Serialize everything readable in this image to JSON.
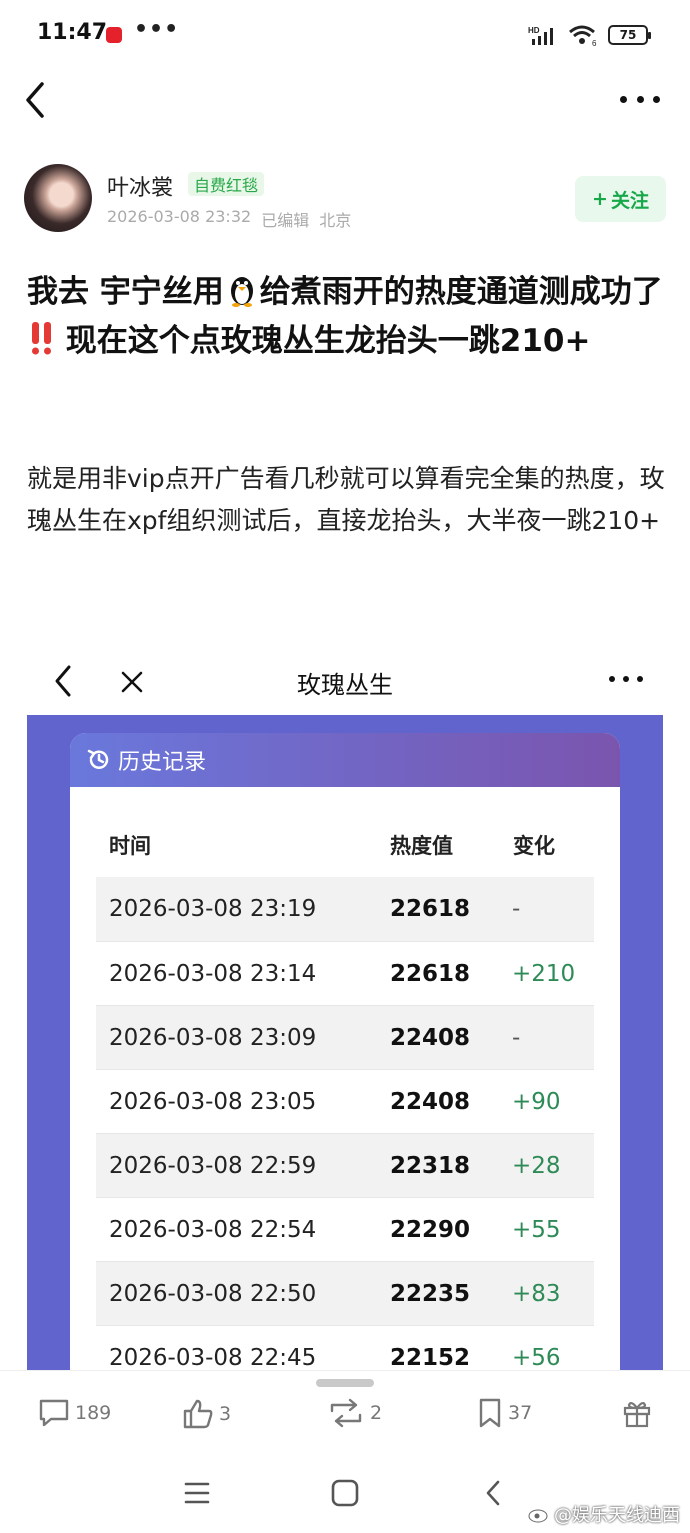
{
  "status_bar": {
    "time": "11:47",
    "more_dots": "•••",
    "network": "HD",
    "wifi_sub": "6",
    "battery": "75"
  },
  "author": {
    "name": "叶冰裳",
    "badge": "自费红毯",
    "date": "2026-03-08 23:32",
    "edited": "已编辑",
    "location": "北京",
    "follow_label": "关注",
    "follow_plus": "+"
  },
  "post": {
    "title_part1": "我去 宇宁丝用",
    "title_part2": "给煮雨开的热度通道测成功了",
    "title_part3": " 现在这个点玫瑰丛生龙抬头一跳210+",
    "body": "就是用非vip点开广告看几秒就可以算看完全集的热度，玫瑰丛生在xpf组织测试后，直接龙抬头，大半夜一跳210+"
  },
  "embed": {
    "title": "玫瑰丛生",
    "history_title": "历史记录",
    "columns": [
      "时间",
      "热度值",
      "变化"
    ],
    "rows": [
      {
        "time": "2026-03-08 23:19",
        "value": "22618",
        "change": "-"
      },
      {
        "time": "2026-03-08 23:14",
        "value": "22618",
        "change": "+210"
      },
      {
        "time": "2026-03-08 23:09",
        "value": "22408",
        "change": "-"
      },
      {
        "time": "2026-03-08 23:05",
        "value": "22408",
        "change": "+90"
      },
      {
        "time": "2026-03-08 22:59",
        "value": "22318",
        "change": "+28"
      },
      {
        "time": "2026-03-08 22:54",
        "value": "22290",
        "change": "+55"
      },
      {
        "time": "2026-03-08 22:50",
        "value": "22235",
        "change": "+83"
      },
      {
        "time": "2026-03-08 22:45",
        "value": "22152",
        "change": "+56"
      }
    ]
  },
  "actions": {
    "comments": "189",
    "likes": "3",
    "reposts": "2",
    "favorites": "37"
  },
  "watermark": "@娱乐天线迪西",
  "colors": {
    "accent_green": "#17a849",
    "change_green": "#2e8b57",
    "embed_blue": "#6064cc",
    "header_gradient_start": "#6a78dc",
    "header_gradient_end": "#7a55ae"
  }
}
